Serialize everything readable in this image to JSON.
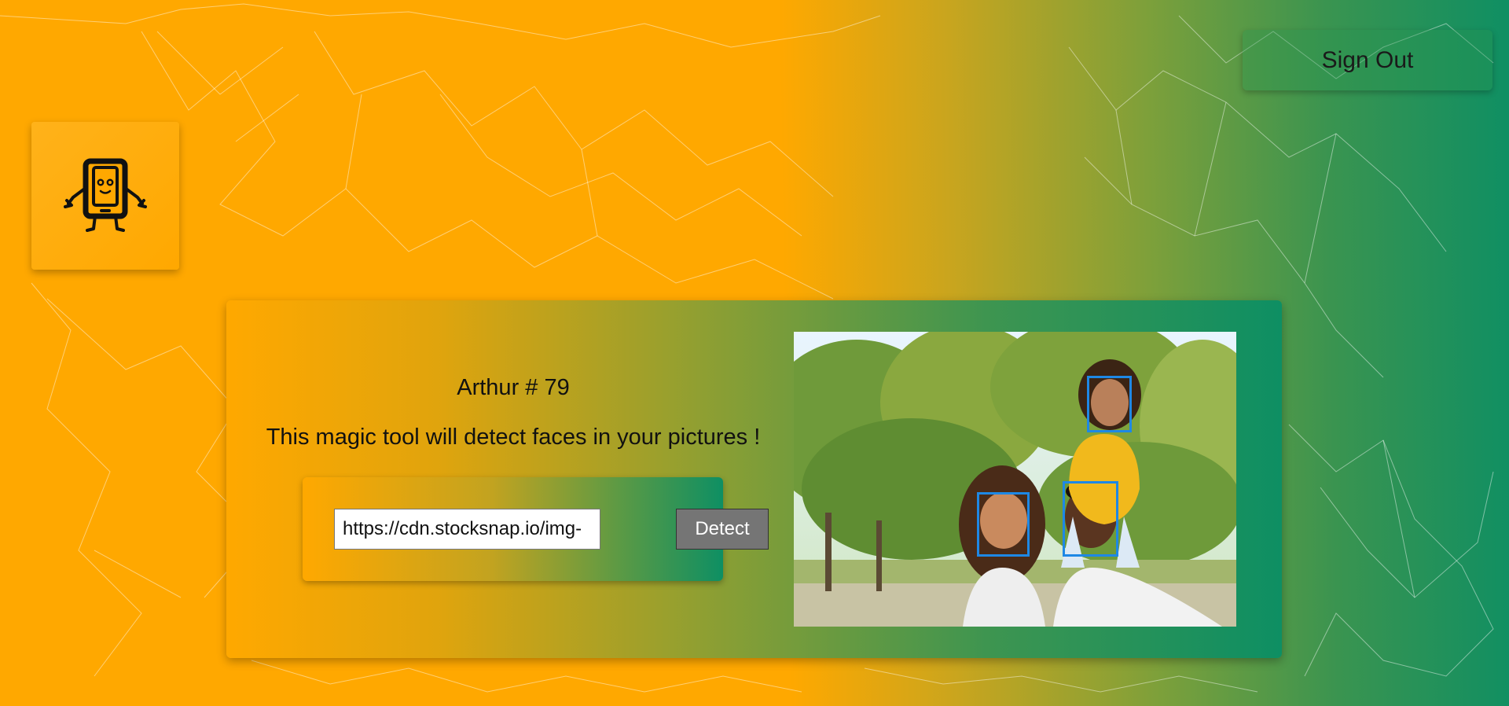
{
  "header": {
    "sign_out_label": "Sign Out"
  },
  "logo": {
    "icon": "tablet-robot-icon"
  },
  "main": {
    "rank_text": "Arthur # 79",
    "tagline": "This magic tool will detect faces in your pictures !",
    "url_input_value": "https://cdn.stocksnap.io/img-",
    "detect_label": "Detect"
  },
  "image": {
    "faces_detected": 3,
    "box_color": "#1e88e5"
  },
  "colors": {
    "orange": "#ffa800",
    "green": "#0f8f63",
    "button_grey": "#757575"
  }
}
